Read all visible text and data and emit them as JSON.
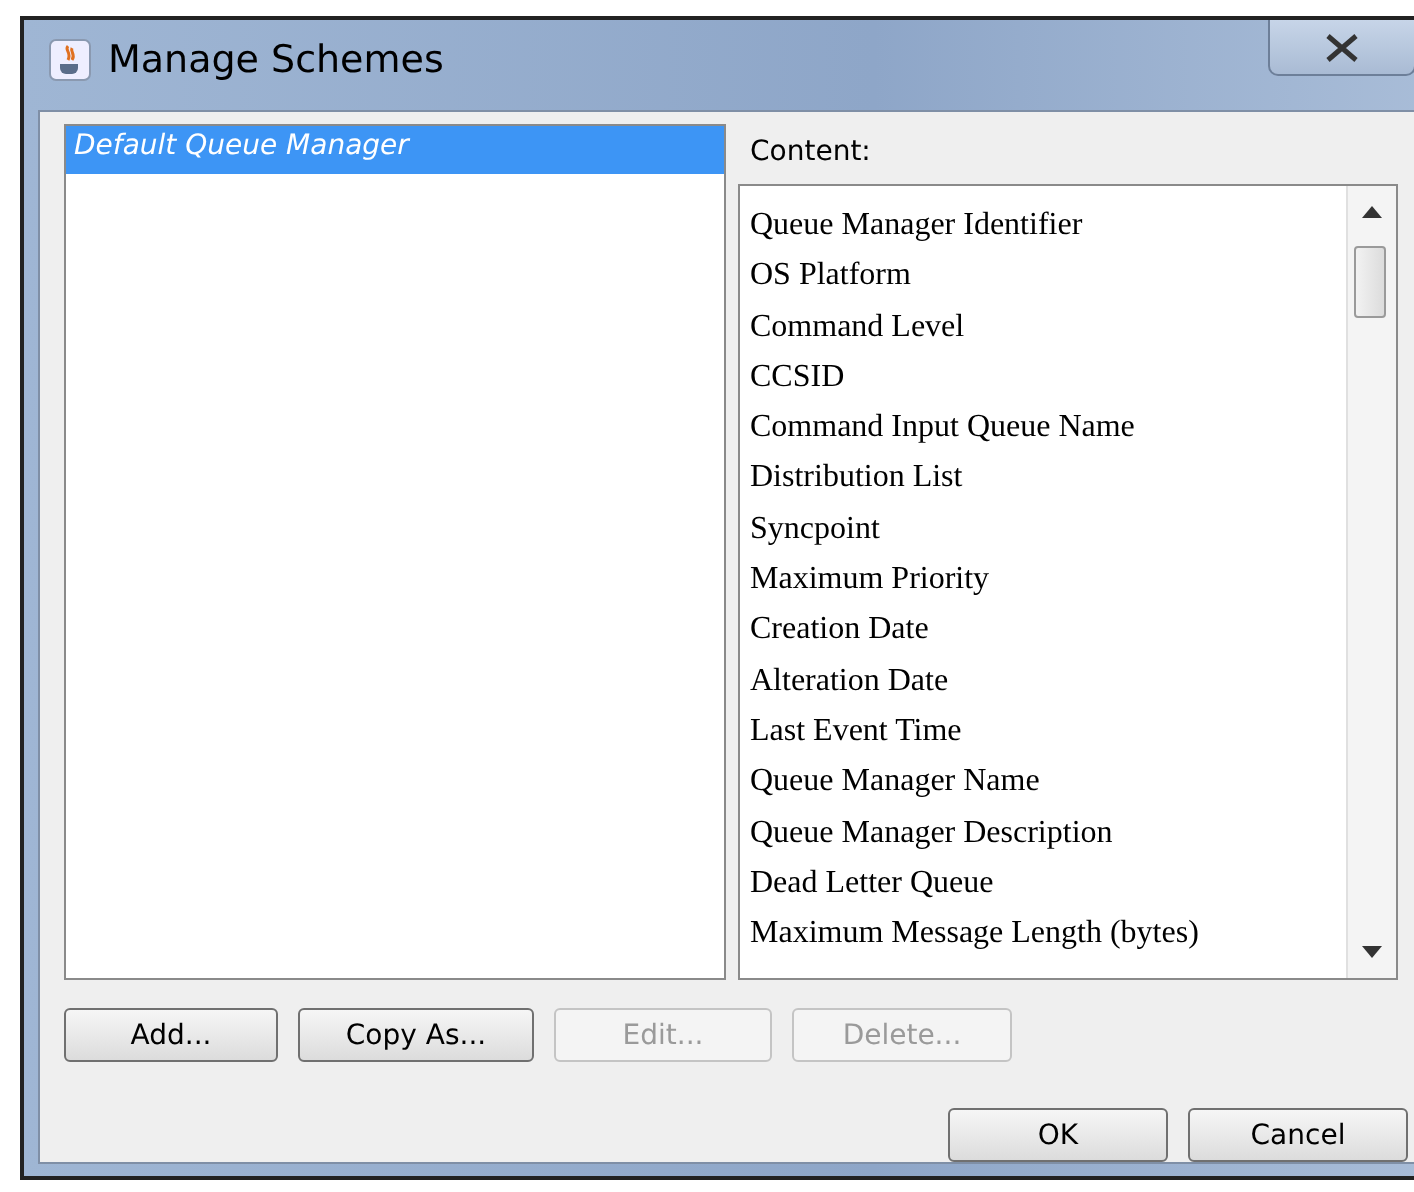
{
  "window": {
    "title": "Manage Schemes"
  },
  "schemes": [
    {
      "label": "Default Queue Manager",
      "selected": true
    }
  ],
  "content": {
    "label": "Content:",
    "items": [
      "Queue Manager Identifier",
      "OS Platform",
      "Command Level",
      "CCSID",
      "Command Input Queue Name",
      "Distribution List",
      "Syncpoint",
      "Maximum Priority",
      "Creation Date",
      "Alteration Date",
      "Last Event Time",
      "Queue Manager Name",
      "Queue Manager Description",
      "Dead Letter Queue",
      "Maximum Message Length (bytes)"
    ]
  },
  "actions": [
    {
      "label": "Add...",
      "disabled": false
    },
    {
      "label": "Copy As...",
      "disabled": false
    },
    {
      "label": "Edit...",
      "disabled": true
    },
    {
      "label": "Delete...",
      "disabled": true
    }
  ],
  "dialog_buttons": [
    "OK",
    "Cancel"
  ]
}
